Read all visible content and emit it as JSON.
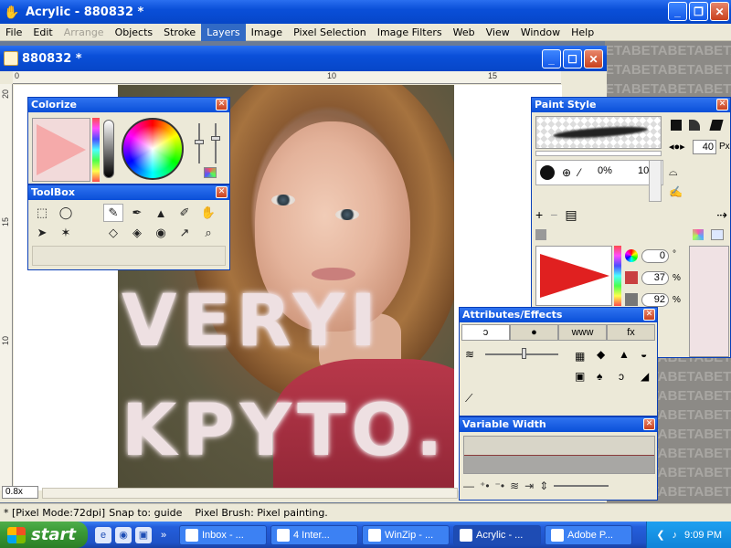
{
  "app": {
    "title": "Acrylic - 880832 *",
    "window_buttons": [
      "_",
      "❐",
      "✕"
    ]
  },
  "menu": {
    "items": [
      {
        "label": "File",
        "state": "normal"
      },
      {
        "label": "Edit",
        "state": "normal"
      },
      {
        "label": "Arrange",
        "state": "disabled"
      },
      {
        "label": "Objects",
        "state": "normal"
      },
      {
        "label": "Stroke",
        "state": "normal"
      },
      {
        "label": "Layers",
        "state": "active"
      },
      {
        "label": "Image",
        "state": "normal"
      },
      {
        "label": "Pixel Selection",
        "state": "normal"
      },
      {
        "label": "Image Filters",
        "state": "normal"
      },
      {
        "label": "Web",
        "state": "normal"
      },
      {
        "label": "View",
        "state": "normal"
      },
      {
        "label": "Window",
        "state": "normal"
      },
      {
        "label": "Help",
        "state": "normal"
      }
    ]
  },
  "background": {
    "watermark": "ETABETABETABETA"
  },
  "document": {
    "title": "880832 *",
    "ruler_h": [
      "0",
      "10",
      "15"
    ],
    "ruler_v": [
      "20",
      "15",
      "10"
    ],
    "zoom": "0.8x",
    "canvas_text_line1": "VERYI",
    "canvas_text_line2": "KPYTO."
  },
  "colorize": {
    "title": "Colorize",
    "close": "✕"
  },
  "toolbox": {
    "title": "ToolBox",
    "close": "✕",
    "tools": [
      {
        "name": "rect-select-icon",
        "glyph": "⬚"
      },
      {
        "name": "lasso-icon",
        "glyph": "◯"
      },
      {
        "name": "spacer",
        "glyph": ""
      },
      {
        "name": "brush-icon",
        "glyph": "✎"
      },
      {
        "name": "pen-icon",
        "glyph": "✒"
      },
      {
        "name": "stamp-icon",
        "glyph": "▲"
      },
      {
        "name": "eyedropper-icon",
        "glyph": "✐"
      },
      {
        "name": "hand-icon",
        "glyph": "✋"
      },
      {
        "name": "move-icon",
        "glyph": "➤"
      },
      {
        "name": "magic-wand-icon",
        "glyph": "✶"
      },
      {
        "name": "spacer",
        "glyph": ""
      },
      {
        "name": "eraser-icon",
        "glyph": "◇"
      },
      {
        "name": "fill-icon",
        "glyph": "◈"
      },
      {
        "name": "redeye-icon",
        "glyph": "◉"
      },
      {
        "name": "picker-icon",
        "glyph": "↗"
      },
      {
        "name": "zoom-icon",
        "glyph": "⌕"
      }
    ]
  },
  "paint_style": {
    "title": "Paint Style",
    "close": "✕",
    "size_value": "40",
    "size_unit": "Px",
    "opacity_pct": "0%",
    "count": "10",
    "hue_value": "0",
    "hue_unit": "°",
    "sat_value": "37",
    "sat_unit": "%",
    "light_value": "92",
    "light_unit": "%"
  },
  "attributes": {
    "title": "Attributes/Effects",
    "close": "✕",
    "tabs": [
      "ↄ",
      "●",
      "www",
      "fx"
    ]
  },
  "variable_width": {
    "title": "Variable Width",
    "close": "✕"
  },
  "status": {
    "mode": "* [Pixel Mode:72dpi]",
    "snap": "Snap to: guide",
    "tool": "Pixel Brush: Pixel painting."
  },
  "taskbar": {
    "start": "start",
    "tasks": [
      {
        "label": "Inbox - ...",
        "active": false
      },
      {
        "label": "4 Inter...",
        "active": false
      },
      {
        "label": "WinZip - ...",
        "active": false
      },
      {
        "label": "Acrylic - ...",
        "active": true
      },
      {
        "label": "Adobe P...",
        "active": false
      }
    ],
    "time": "9:09 PM"
  }
}
